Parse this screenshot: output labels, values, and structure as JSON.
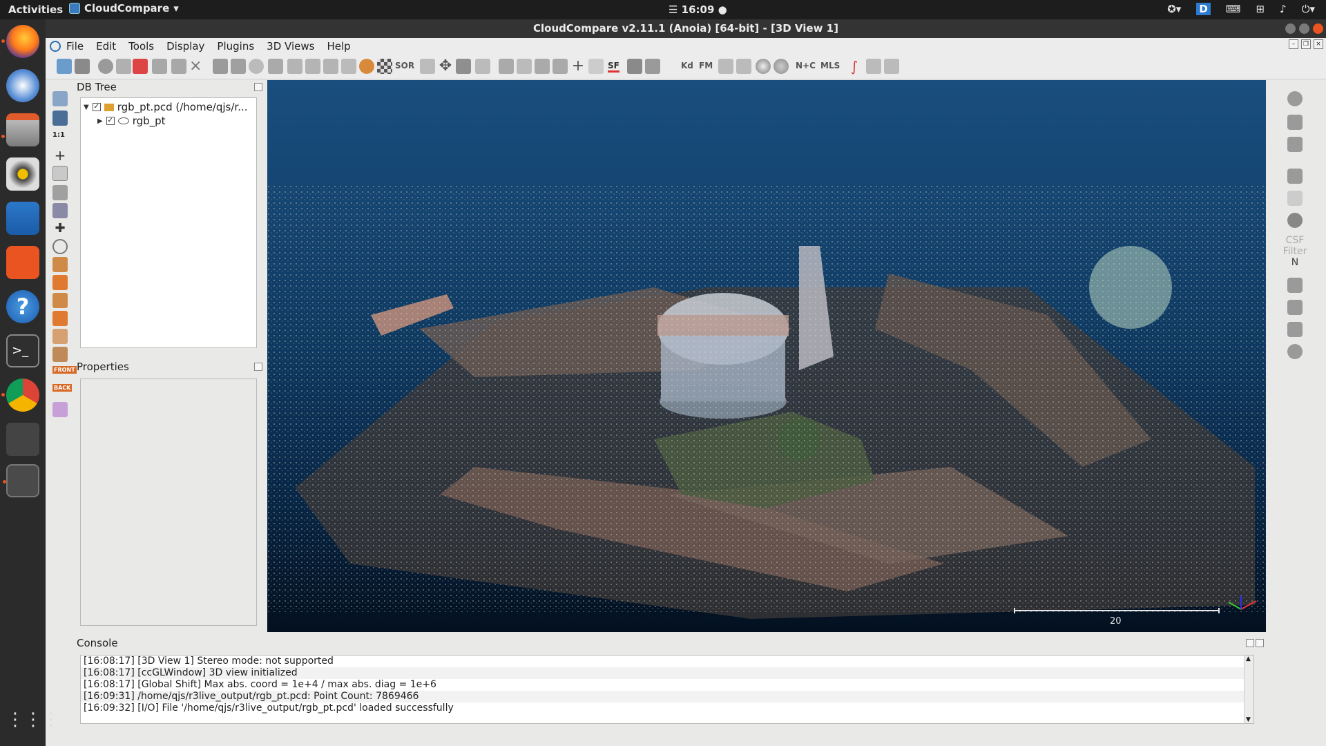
{
  "topbar": {
    "activities": "Activities",
    "app_name": "CloudCompare",
    "clock": "16:09"
  },
  "window": {
    "title": "CloudCompare v2.11.1 (Anoia) [64-bit] - [3D View 1]"
  },
  "menubar": {
    "items": [
      "File",
      "Edit",
      "Tools",
      "Display",
      "Plugins",
      "3D Views",
      "Help"
    ]
  },
  "toolbar": {
    "labels": {
      "sor": "SOR",
      "sf": "SF",
      "kd": "Kd",
      "fm": "FM",
      "nc": "N+C",
      "mls": "MLS"
    }
  },
  "left_toolbar": {
    "one_to_one": "1:1",
    "front": "FRONT",
    "back": "BACK"
  },
  "db_tree": {
    "title": "DB Tree",
    "file_node": "rgb_pt.pcd (/home/qjs/r...",
    "cloud_node": "rgb_pt"
  },
  "properties": {
    "title": "Properties"
  },
  "view3d": {
    "scale_value": "20"
  },
  "right_toolbar": {
    "csf_label": "CSF Filter",
    "n_label": "N"
  },
  "console": {
    "title": "Console",
    "lines": [
      "[16:08:17] [3D View 1] Stereo mode: not supported",
      "[16:08:17] [ccGLWindow] 3D view initialized",
      "[16:08:17] [Global Shift] Max abs. coord = 1e+4 / max abs. diag = 1e+6",
      "[16:09:31] /home/qjs/r3live_output/rgb_pt.pcd: Point Count: 7869466",
      "[16:09:32] [I/O] File '/home/qjs/r3live_output/rgb_pt.pcd' loaded successfully"
    ]
  },
  "colors": {
    "accent": "#e95420",
    "view_bg_top": "#1a4e7e",
    "view_bg_bottom": "#03101f"
  }
}
